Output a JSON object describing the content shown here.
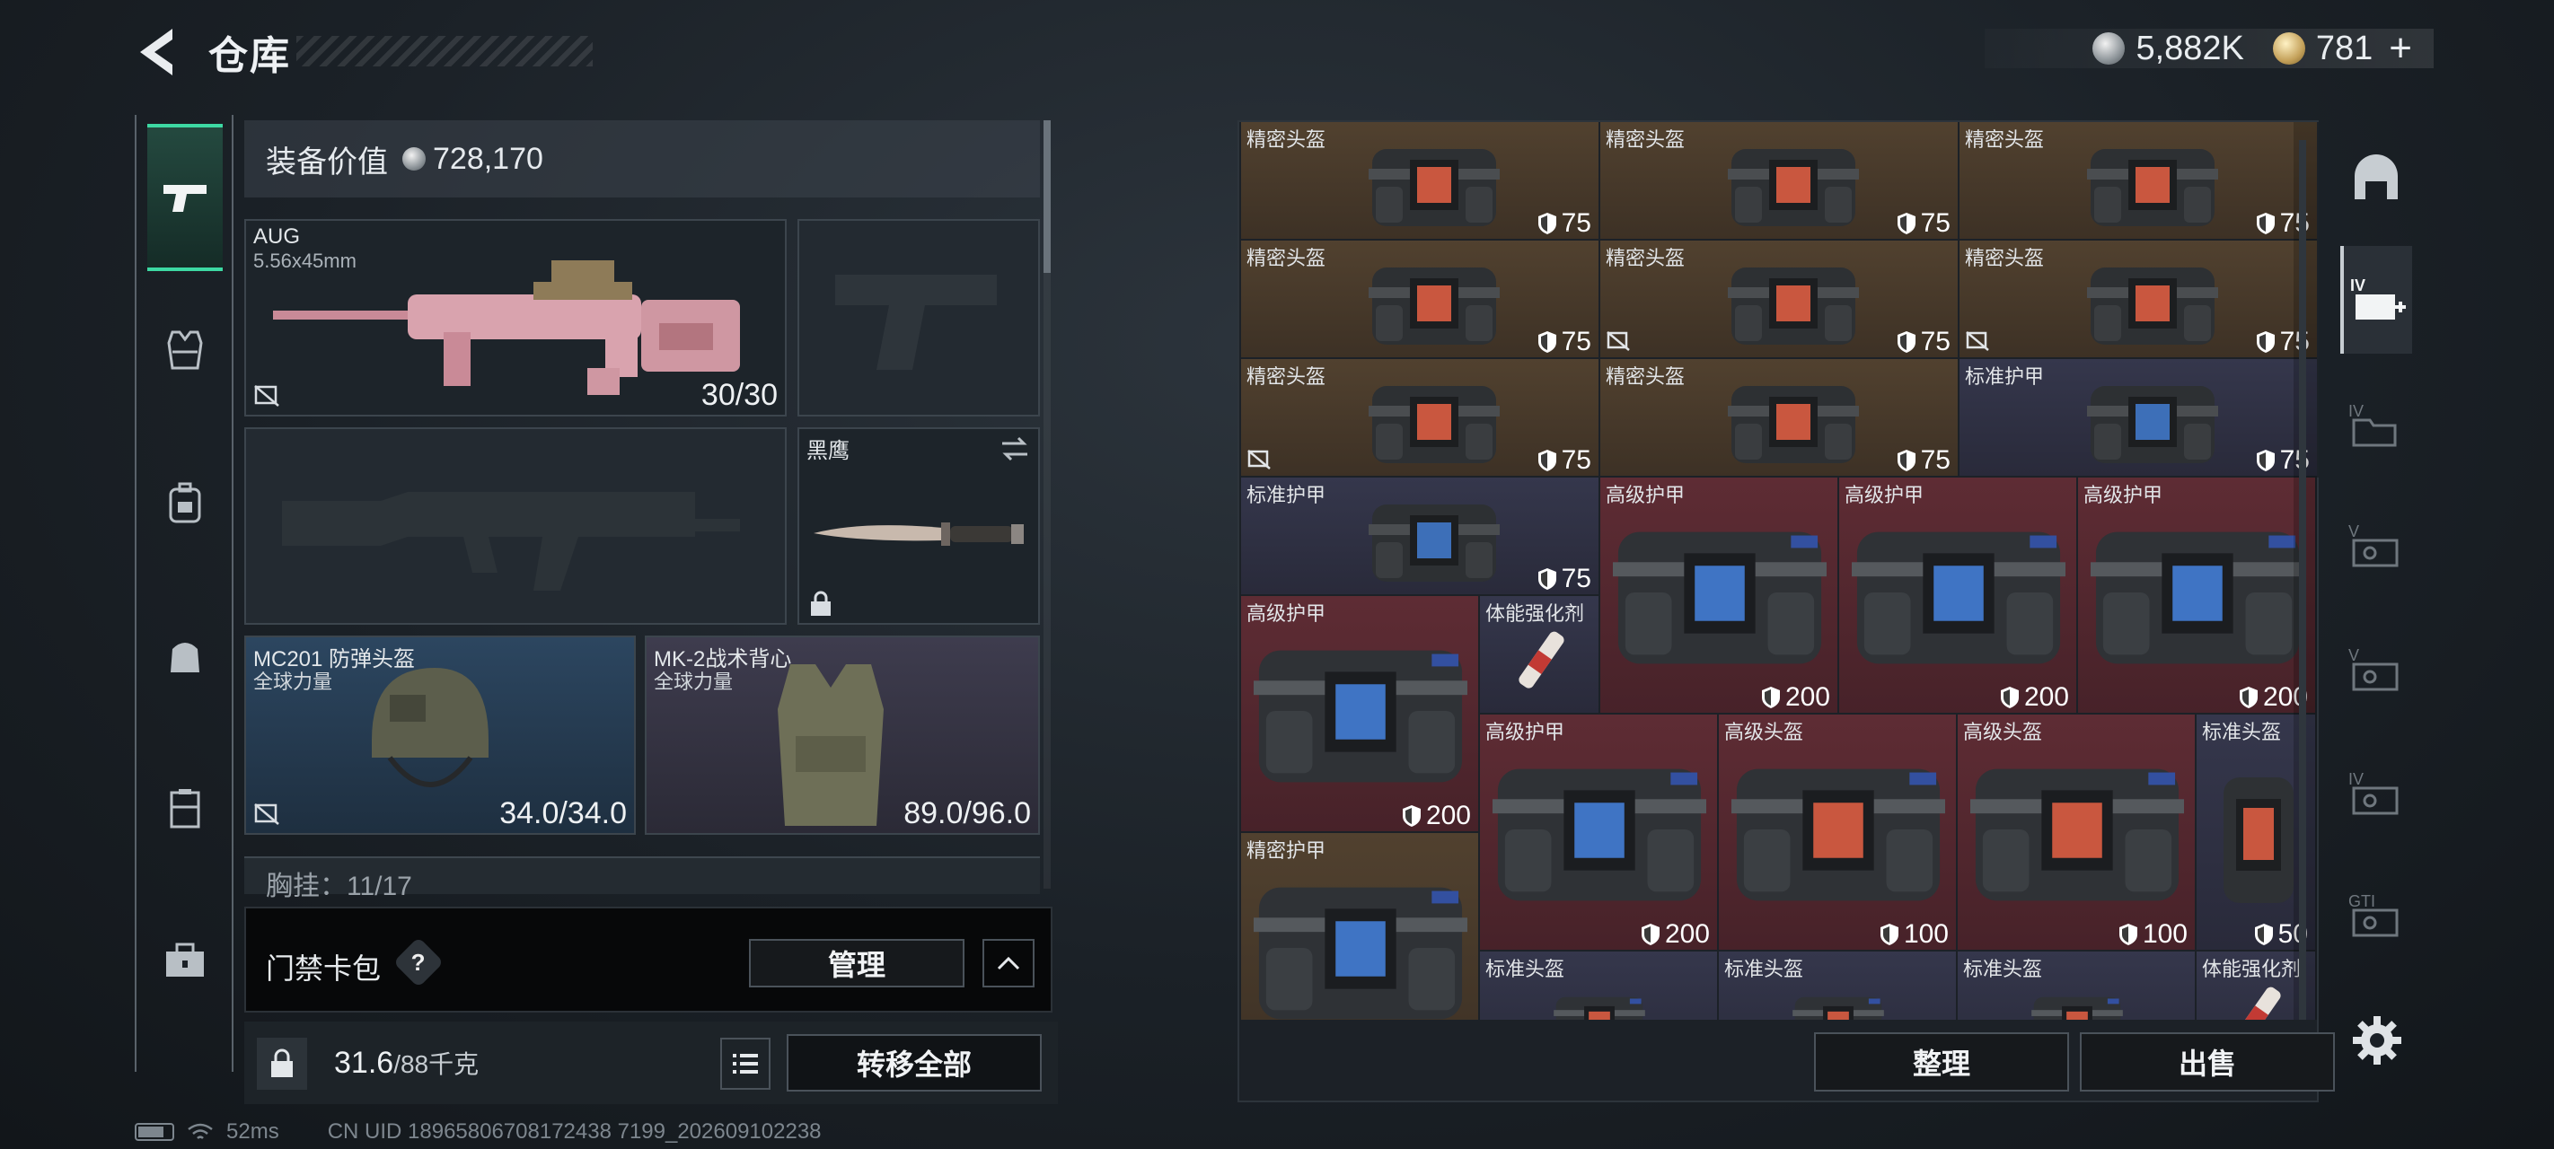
{
  "header": {
    "title": "仓库",
    "currency_1": "5,882K",
    "currency_2": "781"
  },
  "left_tabs": [
    "weapon",
    "armor-vest",
    "backpack",
    "pouch",
    "container",
    "toolbox"
  ],
  "loadout": {
    "equipment_value_label": "装备价值",
    "equipment_value": "728,170",
    "primary_weapon": {
      "name": "AUG",
      "caliber": "5.56x45mm",
      "ammo": "30/30"
    },
    "secondary_weapon": {
      "name": ""
    },
    "primary_weapon_2": {
      "name": ""
    },
    "melee": {
      "name": "黑鹰"
    },
    "helmet": {
      "name": "MC201 防弹头盔",
      "maker": "全球力量",
      "durability": "34.0/34.0"
    },
    "armor": {
      "name": "MK-2战术背心",
      "maker": "全球力量",
      "durability": "89.0/96.0"
    },
    "chest_rig": "胸挂：11/17"
  },
  "keycard": {
    "label": "门禁卡包",
    "help": "?",
    "manage_label": "管理"
  },
  "weight": {
    "current": "31.6",
    "max": "/88千克",
    "transfer_all_label": "转移全部"
  },
  "status": {
    "ping": "52ms",
    "uid": "CN UID 18965806708172438 7199_202609102238"
  },
  "stash": {
    "items": [
      {
        "label": "精密头盔",
        "value": "75",
        "color": "brown"
      },
      {
        "label": "精密头盔",
        "value": "75",
        "color": "brown"
      },
      {
        "label": "精密头盔",
        "value": "75",
        "color": "brown"
      },
      {
        "label": "精密头盔",
        "value": "75",
        "color": "brown"
      },
      {
        "label": "精密头盔",
        "value": "75",
        "color": "brown"
      },
      {
        "label": "精密头盔",
        "value": "75",
        "color": "brown"
      },
      {
        "label": "精密头盔",
        "value": "75",
        "color": "brown"
      },
      {
        "label": "精密头盔",
        "value": "75",
        "color": "brown"
      },
      {
        "label": "标准护甲",
        "value": "75",
        "color": "blue"
      },
      {
        "label": "标准护甲",
        "value": "75",
        "color": "blue"
      },
      {
        "label": "高级护甲",
        "value": "200",
        "color": "red"
      },
      {
        "label": "高级护甲",
        "value": "200",
        "color": "red"
      },
      {
        "label": "高级护甲",
        "value": "200",
        "color": "red"
      },
      {
        "label": "高级护甲",
        "value": "200",
        "color": "red"
      },
      {
        "label": "体能强化剂",
        "value": "",
        "color": "blue"
      },
      {
        "label": "高级护甲",
        "value": "200",
        "color": "red"
      },
      {
        "label": "高级头盔",
        "value": "100",
        "color": "red"
      },
      {
        "label": "高级头盔",
        "value": "100",
        "color": "red"
      },
      {
        "label": "标准头盔",
        "value": "50",
        "color": "blue"
      },
      {
        "label": "精密护甲",
        "value": "",
        "color": "brown"
      },
      {
        "label": "标准头盔",
        "value": "",
        "color": "blue"
      },
      {
        "label": "标准头盔",
        "value": "",
        "color": "blue"
      },
      {
        "label": "标准头盔",
        "value": "",
        "color": "blue"
      },
      {
        "label": "体能强化剂",
        "value": "",
        "color": "blue"
      }
    ],
    "sort_label": "整理",
    "sell_label": "出售"
  },
  "right_tabs": [
    "helmet-tab",
    "add-stash-tab",
    "folder-tab",
    "chest-tab-1",
    "chest-tab-2",
    "chest-tab-3",
    "chest-tab-4"
  ],
  "colors": {
    "accent": "#3dd9a3",
    "brown_cell": "#51412f",
    "blue_cell": "#35374c",
    "red_cell": "#5e2c34"
  }
}
